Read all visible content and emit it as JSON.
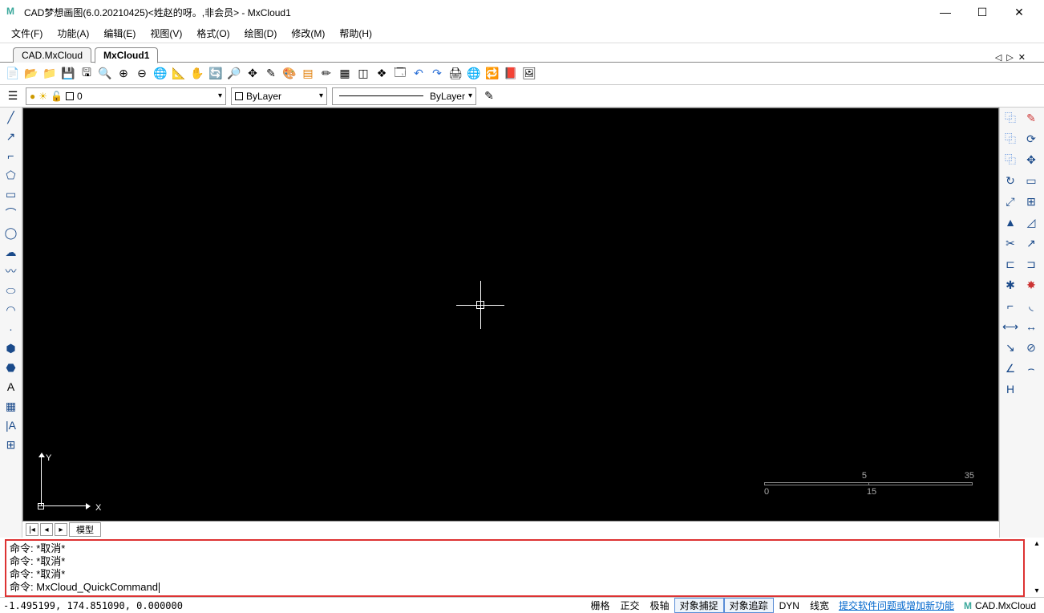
{
  "window": {
    "title": "CAD梦想画图(6.0.20210425)<姓赵的呀。,非会员> - MxCloud1"
  },
  "menu": {
    "file": "文件(F)",
    "feature": "功能(A)",
    "edit": "编辑(E)",
    "view": "视图(V)",
    "format": "格式(O)",
    "draw": "绘图(D)",
    "modify": "修改(M)",
    "help": "帮助(H)"
  },
  "tabs": {
    "tab1": "CAD.MxCloud",
    "tab2": "MxCloud1"
  },
  "props": {
    "layer_value": "0",
    "color_value": "ByLayer",
    "linetype_value": "ByLayer"
  },
  "ucs": {
    "x": "X",
    "y": "Y"
  },
  "scale": {
    "left": "0",
    "midtop": "5",
    "midbot": "15",
    "right": "35"
  },
  "model_tab": "模型",
  "command": {
    "l1": "命令:  *取消*",
    "l2": "命令:  *取消*",
    "l3": "命令:  *取消*",
    "prefix": "命令: ",
    "input": "MxCloud_QuickCommand"
  },
  "status": {
    "coords": "-1.495199,  174.851090,  0.000000",
    "grid": "栅格",
    "ortho": "正交",
    "polar": "极轴",
    "osnap": "对象捕捉",
    "otrack": "对象追踪",
    "dyn": "DYN",
    "lwt": "线宽",
    "feedback": "提交软件问题或增加新功能",
    "product": "CAD.MxCloud"
  }
}
